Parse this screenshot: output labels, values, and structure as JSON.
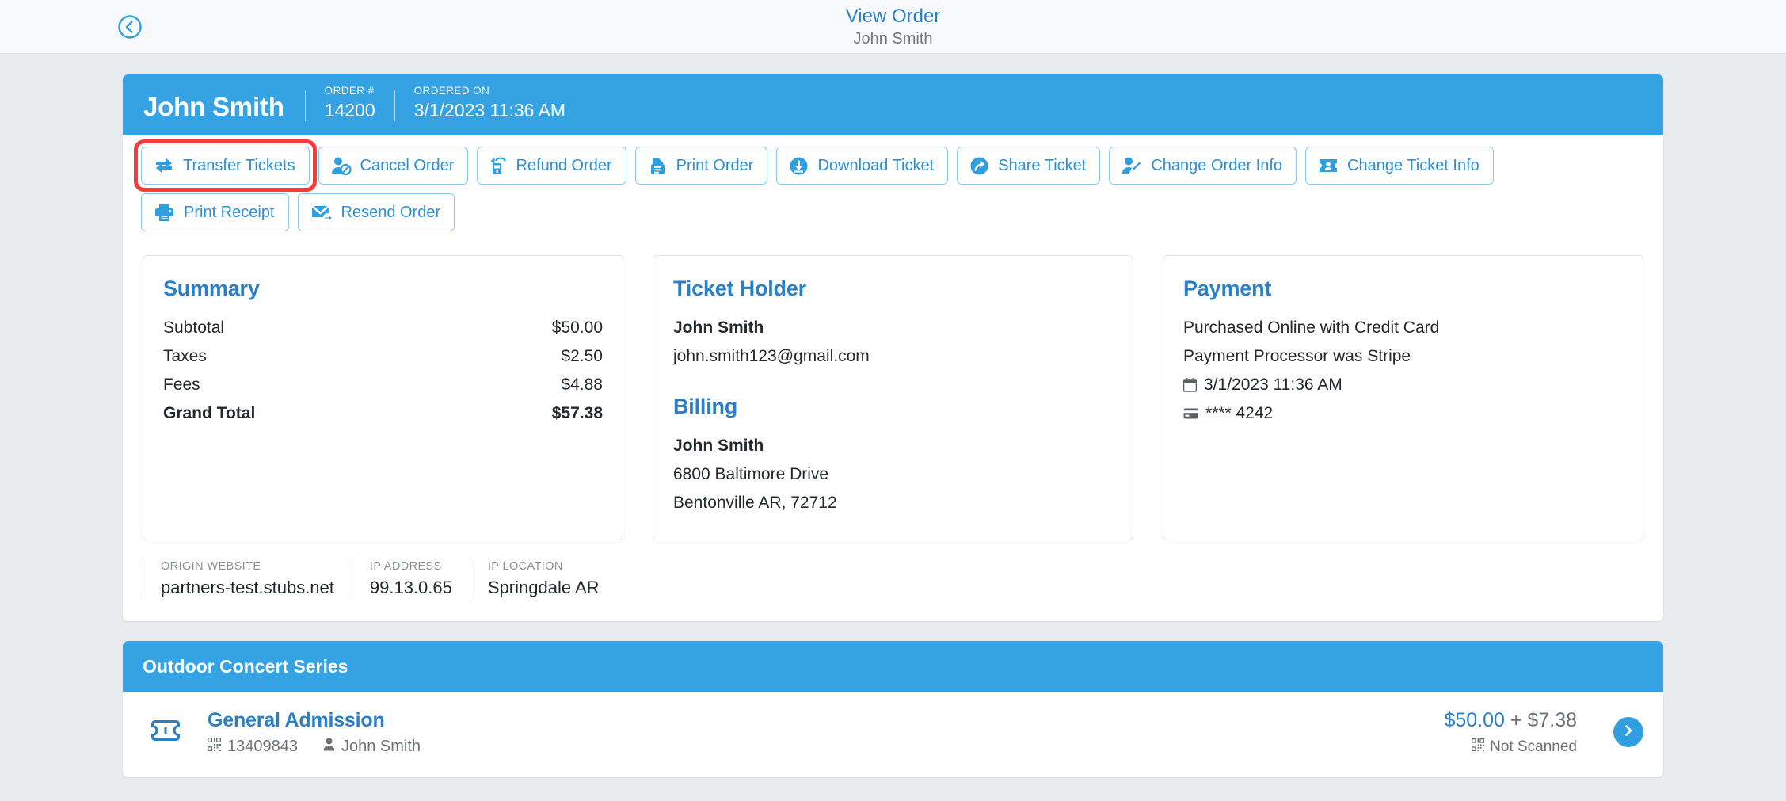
{
  "topbar": {
    "back_icon": "chevron-left-circle-icon",
    "title": "View Order",
    "subtitle": "John Smith"
  },
  "order": {
    "customer_name": "John Smith",
    "fields": [
      {
        "label": "ORDER #",
        "value": "14200"
      },
      {
        "label": "ORDERED ON",
        "value": "3/1/2023 11:36 AM"
      }
    ]
  },
  "actions": {
    "highlight_color": "#fa3b3b",
    "buttons": [
      {
        "label": "Transfer Tickets",
        "icon": "transfer-arrows-icon",
        "highlighted": true
      },
      {
        "label": "Cancel Order",
        "icon": "user-cancel-icon",
        "highlighted": false
      },
      {
        "label": "Refund Order",
        "icon": "refund-icon",
        "highlighted": false
      },
      {
        "label": "Print Order",
        "icon": "print-order-icon",
        "highlighted": false
      },
      {
        "label": "Download Ticket",
        "icon": "download-circle-icon",
        "highlighted": false
      },
      {
        "label": "Share Ticket",
        "icon": "share-circle-icon",
        "highlighted": false
      },
      {
        "label": "Change Order Info",
        "icon": "user-edit-icon",
        "highlighted": false
      },
      {
        "label": "Change Ticket Info",
        "icon": "ticket-user-icon",
        "highlighted": false
      },
      {
        "label": "Print Receipt",
        "icon": "printer-icon",
        "highlighted": false
      },
      {
        "label": "Resend Order",
        "icon": "envelope-resend-icon",
        "highlighted": false
      }
    ]
  },
  "summary": {
    "title": "Summary",
    "rows": [
      {
        "label": "Subtotal",
        "value": "$50.00"
      },
      {
        "label": "Taxes",
        "value": "$2.50"
      },
      {
        "label": "Fees",
        "value": "$4.88"
      }
    ],
    "total": {
      "label": "Grand Total",
      "value": "$57.38"
    }
  },
  "ticket_holder": {
    "title": "Ticket Holder",
    "name": "John Smith",
    "email": "john.smith123@gmail.com",
    "billing_title": "Billing",
    "billing_name": "John Smith",
    "billing_address1": "6800 Baltimore Drive",
    "billing_address2": "Bentonville AR, 72712"
  },
  "payment": {
    "title": "Payment",
    "method": "Purchased Online with Credit Card",
    "processor": "Payment Processor was Stripe",
    "date": "3/1/2023 11:36 AM",
    "date_icon": "calendar-icon",
    "card": "**** 4242",
    "card_icon": "credit-card-icon"
  },
  "meta": [
    {
      "label": "ORIGIN WEBSITE",
      "value": "partners-test.stubs.net"
    },
    {
      "label": "IP ADDRESS",
      "value": "99.13.0.65"
    },
    {
      "label": "IP LOCATION",
      "value": "Springdale AR"
    }
  ],
  "event": {
    "title": "Outdoor Concert Series",
    "ticket": {
      "icon": "ticket-icon",
      "name": "General Admission",
      "barcode_icon": "qr-code-icon",
      "barcode": "13409843",
      "holder_icon": "person-icon",
      "holder": "John Smith",
      "price": "$50.00",
      "fees": "+ $7.38",
      "scan_icon": "qr-code-icon",
      "scan_status": "Not Scanned",
      "chevron_icon": "chevron-right-icon"
    }
  },
  "colors": {
    "accent_blue": "#35a3e3",
    "link_blue": "#2a7fc9",
    "page_bg": "#e9ecee",
    "highlight_red": "#fa3b3b"
  }
}
